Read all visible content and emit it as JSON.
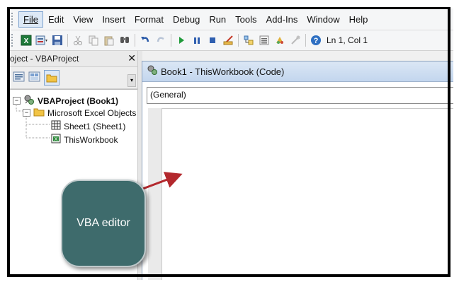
{
  "menu": {
    "items": [
      {
        "label": "File",
        "active": true
      },
      {
        "label": "Edit"
      },
      {
        "label": "View"
      },
      {
        "label": "Insert"
      },
      {
        "label": "Format"
      },
      {
        "label": "Debug"
      },
      {
        "label": "Run"
      },
      {
        "label": "Tools"
      },
      {
        "label": "Add-Ins"
      },
      {
        "label": "Window"
      },
      {
        "label": "Help"
      }
    ]
  },
  "toolbar": {
    "icons": [
      "excel-icon",
      "insert-module-icon",
      "save-icon",
      "cut-icon",
      "copy-icon",
      "paste-icon",
      "find-icon",
      "undo-icon",
      "redo-icon",
      "run-icon",
      "break-icon",
      "reset-icon",
      "design-mode-icon",
      "project-explorer-icon",
      "properties-icon",
      "object-browser-icon",
      "toolbox-icon",
      "help-icon"
    ],
    "position": "Ln 1, Col 1"
  },
  "project": {
    "title": "Project - VBAProject",
    "close": "✕",
    "tree": {
      "root": "VBAProject (Book1)",
      "folder": "Microsoft Excel Objects",
      "items": [
        "Sheet1 (Sheet1)",
        "ThisWorkbook"
      ]
    }
  },
  "code_window": {
    "title": "Book1 - ThisWorkbook (Code)",
    "object_dropdown": "(General)"
  },
  "annotation": {
    "label": "VBA editor",
    "fill": "#3e6b6c",
    "arrow_color": "#b3282d"
  }
}
